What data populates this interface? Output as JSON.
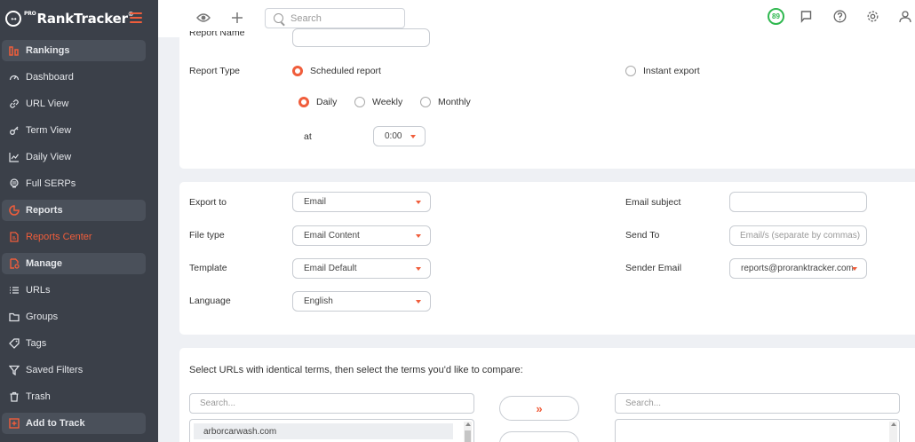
{
  "app": {
    "logo_pro": "PRO",
    "logo_name": "RankTracker",
    "logo_reg": "®"
  },
  "sidebar": {
    "items": [
      {
        "label": "Rankings",
        "icon": "rankings-icon",
        "type": "section"
      },
      {
        "label": "Dashboard",
        "icon": "dashboard-icon",
        "type": "item"
      },
      {
        "label": "URL View",
        "icon": "link-icon",
        "type": "item"
      },
      {
        "label": "Term View",
        "icon": "key-icon",
        "type": "item"
      },
      {
        "label": "Daily View",
        "icon": "line-chart-icon",
        "type": "item"
      },
      {
        "label": "Full SERPs",
        "icon": "serp-icon",
        "type": "item"
      },
      {
        "label": "Reports",
        "icon": "pie-chart-icon",
        "type": "section"
      },
      {
        "label": "Reports Center",
        "icon": "report-file-icon",
        "type": "active"
      },
      {
        "label": "Manage",
        "icon": "manage-icon",
        "type": "section"
      },
      {
        "label": "URLs",
        "icon": "list-icon",
        "type": "item"
      },
      {
        "label": "Groups",
        "icon": "folder-icon",
        "type": "item"
      },
      {
        "label": "Tags",
        "icon": "tag-icon",
        "type": "item"
      },
      {
        "label": "Saved Filters",
        "icon": "filter-icon",
        "type": "item"
      },
      {
        "label": "Trash",
        "icon": "trash-icon",
        "type": "item"
      },
      {
        "label": "Add to Track",
        "icon": "plus-square-icon",
        "type": "section"
      }
    ]
  },
  "topbar": {
    "search_placeholder": "Search",
    "score": "89"
  },
  "schedule": {
    "report_name_label": "Report Name",
    "report_type_label": "Report Type",
    "scheduled_label": "Scheduled report",
    "instant_label": "Instant export",
    "daily_label": "Daily",
    "weekly_label": "Weekly",
    "monthly_label": "Monthly",
    "at_label": "at",
    "time_value": "0:00"
  },
  "export": {
    "export_to_label": "Export to",
    "export_to_value": "Email",
    "file_type_label": "File type",
    "file_type_value": "Email Content",
    "template_label": "Template",
    "template_value": "Email Default",
    "language_label": "Language",
    "language_value": "English",
    "email_subject_label": "Email subject",
    "email_subject_value": "",
    "send_to_label": "Send To",
    "send_to_placeholder": "Email/s (separate by commas)",
    "sender_email_label": "Sender Email",
    "sender_email_value": "reports@proranktracker.com"
  },
  "compare": {
    "instruction": "Select URLs with identical terms, then select the terms you'd like to compare:",
    "left_search_placeholder": "Search...",
    "right_search_placeholder": "Search...",
    "urls": [
      "arborcarwash.com"
    ],
    "move_right_label": "»"
  }
}
